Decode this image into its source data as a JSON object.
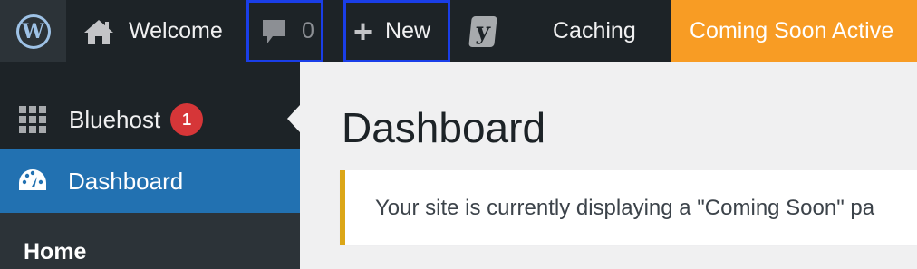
{
  "admin_bar": {
    "wp_logo_icon": "wordpress-logo-icon",
    "site_name": "Welcome",
    "comment_count": "0",
    "new_label": "New",
    "yoast_icon": "yoast-icon",
    "yoast_letter": "y",
    "caching_label": "Caching",
    "coming_soon_label": "Coming Soon Active",
    "colors": {
      "bar_bg": "#1d2327",
      "coming_soon_bg": "#f89c24",
      "highlight_border": "#1a3ee8"
    }
  },
  "sidebar": {
    "items": [
      {
        "label": "Bluehost",
        "icon": "grid-icon",
        "badge": "1"
      },
      {
        "label": "Dashboard",
        "icon": "dashboard-gauge-icon",
        "active": true
      }
    ],
    "submenu": {
      "label": "Home"
    },
    "colors": {
      "active_bg": "#2271b1",
      "badge_bg": "#d63638"
    }
  },
  "main": {
    "title": "Dashboard",
    "notice_text": "Your site is currently displaying a \"Coming Soon\" pa",
    "notice_border_color": "#dba617"
  }
}
